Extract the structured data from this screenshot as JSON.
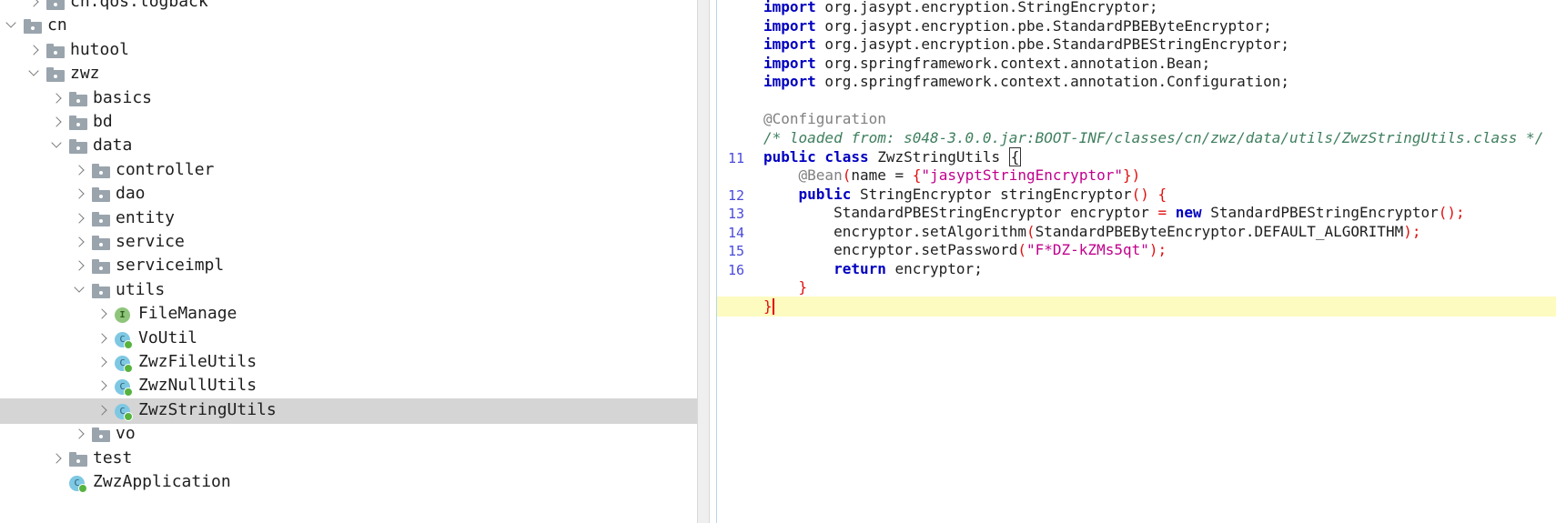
{
  "tree": {
    "rows": [
      {
        "label": "cn.qos.logback",
        "type": "folder",
        "chevron": "right"
      },
      {
        "label": "cn",
        "type": "folder",
        "chevron": "down"
      },
      {
        "label": "hutool",
        "type": "folder",
        "chevron": "right"
      },
      {
        "label": "zwz",
        "type": "folder",
        "chevron": "down"
      },
      {
        "label": "basics",
        "type": "folder",
        "chevron": "right"
      },
      {
        "label": "bd",
        "type": "folder",
        "chevron": "right"
      },
      {
        "label": "data",
        "type": "folder",
        "chevron": "down"
      },
      {
        "label": "controller",
        "type": "folder",
        "chevron": "right"
      },
      {
        "label": "dao",
        "type": "folder",
        "chevron": "right"
      },
      {
        "label": "entity",
        "type": "folder",
        "chevron": "right"
      },
      {
        "label": "service",
        "type": "folder",
        "chevron": "right"
      },
      {
        "label": "serviceimpl",
        "type": "folder",
        "chevron": "right"
      },
      {
        "label": "utils",
        "type": "folder",
        "chevron": "down"
      },
      {
        "label": "FileManage",
        "type": "interface",
        "icon_letter": "I",
        "chevron": "right"
      },
      {
        "label": "VoUtil",
        "type": "class",
        "icon_letter": "C",
        "chevron": "right"
      },
      {
        "label": "ZwzFileUtils",
        "type": "class",
        "icon_letter": "C",
        "chevron": "right"
      },
      {
        "label": "ZwzNullUtils",
        "type": "class",
        "icon_letter": "C",
        "chevron": "right"
      },
      {
        "label": "ZwzStringUtils",
        "type": "class",
        "icon_letter": "C",
        "chevron": "right",
        "selected": true
      },
      {
        "label": "vo",
        "type": "folder",
        "chevron": "right"
      },
      {
        "label": "test",
        "type": "folder",
        "chevron": "right"
      },
      {
        "label": "ZwzApplication",
        "type": "class",
        "icon_letter": "C",
        "chevron": "none"
      }
    ]
  },
  "editor": {
    "lines": [
      {
        "num": "",
        "kw": "import",
        "text": " org.jasypt.encryption.StringEncryptor;"
      },
      {
        "num": "",
        "kw": "import",
        "text": " org.jasypt.encryption.pbe.StandardPBEByteEncryptor;"
      },
      {
        "num": "",
        "kw": "import",
        "text": " org.jasypt.encryption.pbe.StandardPBEStringEncryptor;"
      },
      {
        "num": "",
        "kw": "import",
        "text": " org.springframework.context.annotation.Bean;"
      },
      {
        "num": "",
        "kw": "import",
        "text": " org.springframework.context.annotation.Configuration;"
      },
      {
        "num": "",
        "text": ""
      },
      {
        "num": "",
        "annotation": "@Configuration"
      },
      {
        "num": "",
        "comment": "/* loaded from: s048-3.0.0.jar:BOOT-INF/classes/cn/zwz/data/utils/ZwzStringUtils.class */"
      },
      {
        "num": "11",
        "kw": "public class",
        "text": " ZwzStringUtils ",
        "boxed": "{"
      },
      {
        "num": "",
        "indent": "    ",
        "annotation": "@Bean",
        "paren_open": "(",
        "text": "name = ",
        "brace_open": "{",
        "string": "\"jasyptStringEncryptor\"",
        "brace_close": "})"
      },
      {
        "num": "12",
        "indent": "    ",
        "kw": "public",
        "text": " StringEncryptor stringEncryptor",
        "tail": "() {"
      },
      {
        "num": "13",
        "indent": "        ",
        "text": "StandardPBEStringEncryptor encryptor ",
        "op": "=",
        "kw2": " new",
        "text2": " StandardPBEStringEncryptor",
        "tail": "();"
      },
      {
        "num": "14",
        "indent": "        ",
        "text": "encryptor.setAlgorithm",
        "paren_open": "(",
        "text2": "StandardPBEByteEncryptor.DEFAULT_ALGORITHM",
        "tail": ");"
      },
      {
        "num": "15",
        "indent": "        ",
        "text": "encryptor.setPassword",
        "paren_open": "(",
        "string": "\"F*DZ-kZMs5qt\"",
        "tail": ");"
      },
      {
        "num": "16",
        "indent": "        ",
        "kw": "return",
        "text": " encryptor;"
      },
      {
        "num": "",
        "indent": "    ",
        "brace": "}"
      },
      {
        "num": "",
        "brace": "}",
        "current": true
      }
    ]
  },
  "colors": {
    "keyword": "#0000c0",
    "annotation": "#808080",
    "comment": "#3f7f5f",
    "string": "#c0008c",
    "bracket": "#e01010",
    "current_line": "#fdfbc0",
    "selection": "#d5d5d5",
    "folder": "#9aa4ad",
    "class_icon": "#7ec8e3",
    "interface_icon": "#8fc57b"
  }
}
